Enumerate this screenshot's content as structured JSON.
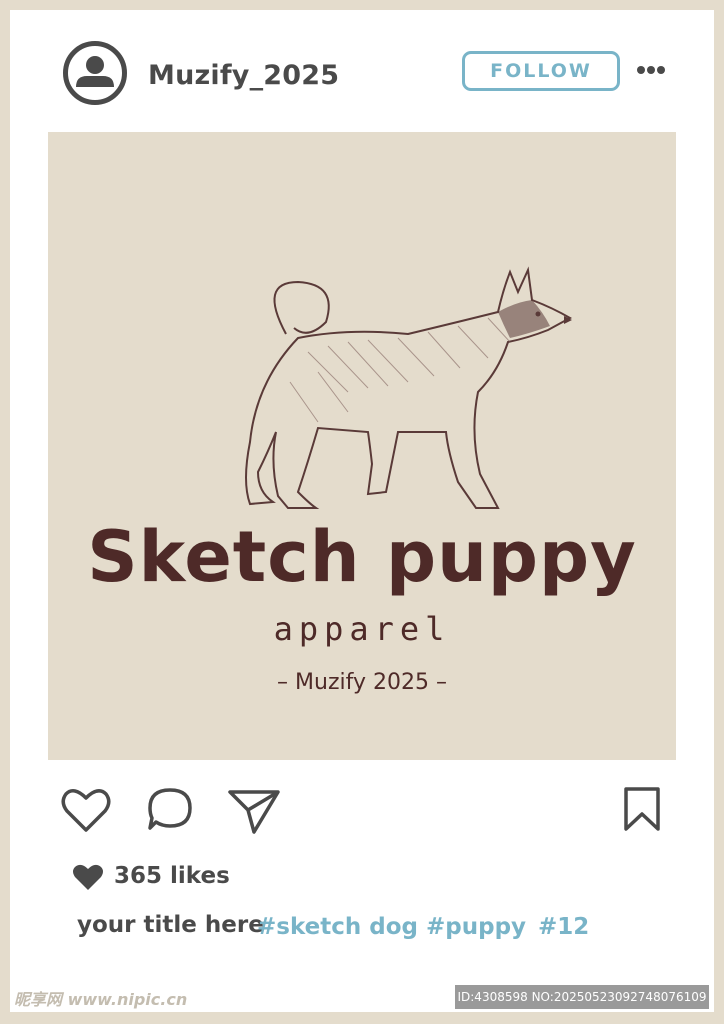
{
  "post": {
    "username": "Muzify_2025",
    "follow_label": "FOLLOW",
    "likes": "365 likes",
    "caption": "your title here",
    "hashtags": [
      "#sketch dog",
      "#puppy",
      "#12"
    ]
  },
  "image": {
    "brand": "Sketch puppy",
    "subtitle": "apparel",
    "signature": "– Muzify 2025 –"
  },
  "watermark": {
    "site": "昵享网 www.nipic.cn",
    "id_text": "ID:4308598 NO:20250523092748076109"
  },
  "colors": {
    "frame": "#e4dccc",
    "accent": "#79b4c8",
    "text": "#4a4a4a",
    "brand": "#4e2a28"
  },
  "icons": [
    "avatar-icon",
    "more-icon",
    "heart-icon",
    "comment-icon",
    "share-icon",
    "bookmark-icon"
  ]
}
